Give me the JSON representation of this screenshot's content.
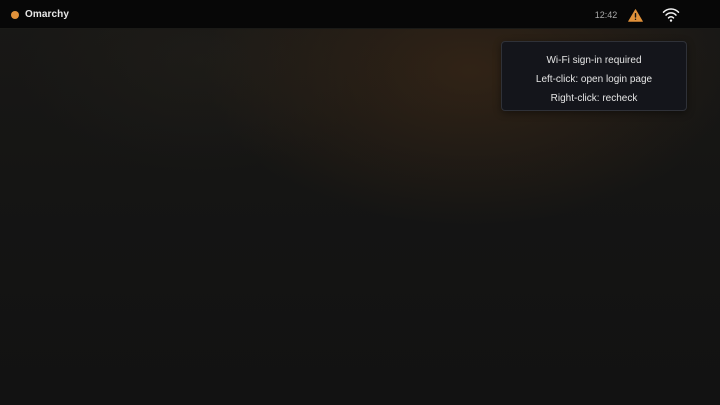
{
  "topbar": {
    "brand_label": "Omarchy",
    "clock": "12:42",
    "icons": [
      "status-dot-icon",
      "warning-icon",
      "wifi-icon"
    ],
    "colors": {
      "brand_dot": "#e0913a",
      "warning": "#e0913a",
      "bar_background": "#070707"
    }
  },
  "tooltip": {
    "line1": "Wi-Fi sign-in required",
    "line2": "Left-click: open login page",
    "line3": "Right-click: recheck"
  }
}
